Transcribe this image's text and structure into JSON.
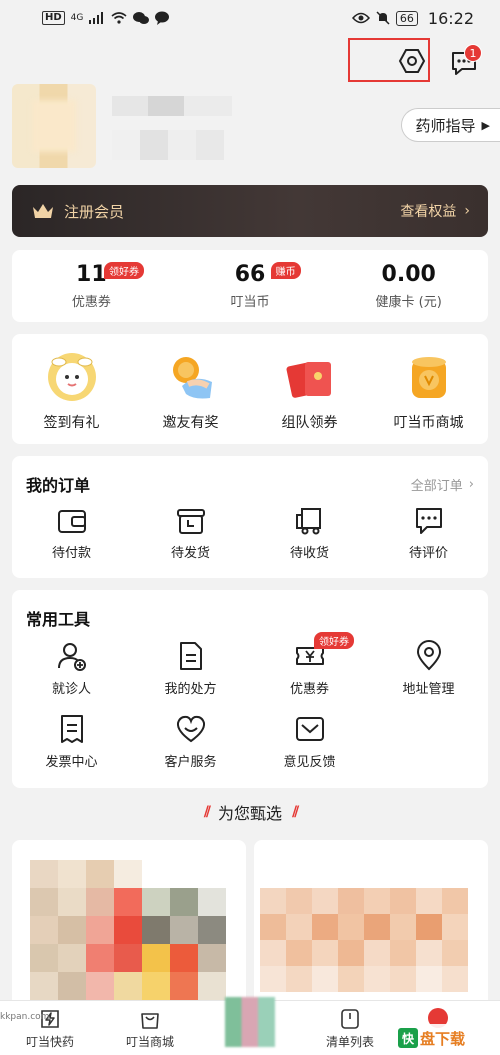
{
  "status_bar": {
    "hd": "HD",
    "signal": "4G",
    "battery": "66",
    "time": "16:22"
  },
  "header": {
    "message_badge": "1",
    "pharmacist_button": "药师指导"
  },
  "member": {
    "label": "注册会员",
    "link": "查看权益"
  },
  "stats": [
    {
      "value": "11",
      "label": "优惠券",
      "tag": "领好券"
    },
    {
      "value": "66",
      "label": "叮当币",
      "tag": "赚币"
    },
    {
      "value": "0.00",
      "label": "健康卡 (元)",
      "tag": ""
    }
  ],
  "promos": [
    {
      "label": "签到有礼",
      "icon": "gift-checkin-icon"
    },
    {
      "label": "邀友有奖",
      "icon": "invite-coin-icon"
    },
    {
      "label": "组队领券",
      "icon": "red-envelope-icon"
    },
    {
      "label": "叮当币商城",
      "icon": "coin-mall-icon"
    }
  ],
  "orders": {
    "title": "我的订单",
    "all_link": "全部订单",
    "items": [
      {
        "label": "待付款",
        "icon": "wallet-icon"
      },
      {
        "label": "待发货",
        "icon": "box-icon"
      },
      {
        "label": "待收货",
        "icon": "truck-icon"
      },
      {
        "label": "待评价",
        "icon": "comment-icon"
      }
    ]
  },
  "tools": {
    "title": "常用工具",
    "coupon_tag": "领好券",
    "items": [
      {
        "label": "就诊人",
        "icon": "patient-add-icon"
      },
      {
        "label": "我的处方",
        "icon": "prescription-icon"
      },
      {
        "label": "优惠券",
        "icon": "coupon-icon"
      },
      {
        "label": "地址管理",
        "icon": "location-icon"
      },
      {
        "label": "发票中心",
        "icon": "invoice-icon"
      },
      {
        "label": "客户服务",
        "icon": "service-heart-icon"
      },
      {
        "label": "意见反馈",
        "icon": "feedback-mail-icon"
      }
    ]
  },
  "recommend_title": "为您甄选",
  "bottom_nav": [
    {
      "label": "叮当快药",
      "icon": "lightning-icon"
    },
    {
      "label": "叮当商城",
      "icon": "shopping-bag-icon"
    },
    {
      "label": "",
      "icon": "center-blur"
    },
    {
      "label": "清单列表",
      "icon": "list-icon"
    },
    {
      "label": "",
      "icon": "profile-icon"
    }
  ],
  "watermark": "kkpan.com",
  "logo_text": {
    "left": "快",
    "mid": "盘下载",
    "sub": ""
  }
}
